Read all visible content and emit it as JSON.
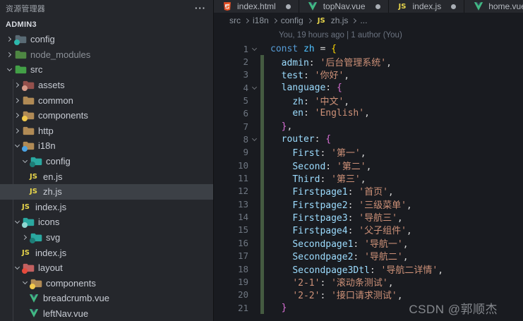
{
  "sidebar": {
    "title": "资源管理器",
    "more_icon": "···",
    "section": "ADMIN3",
    "tree": [
      {
        "label": "config",
        "depth": 0,
        "exp": false,
        "type": "folder",
        "color": "#5a6b75",
        "badge": "#2db8ad",
        "badgeName": "gear-badge"
      },
      {
        "label": "node_modules",
        "depth": 0,
        "exp": false,
        "type": "folder",
        "color": "#4e8743",
        "dim": true
      },
      {
        "label": "src",
        "depth": 0,
        "exp": true,
        "type": "folder",
        "color": "#43a047"
      },
      {
        "label": "assets",
        "depth": 1,
        "exp": false,
        "type": "folder",
        "color": "#94504c",
        "badge": "#d89a8a",
        "badgeName": "image-badge"
      },
      {
        "label": "common",
        "depth": 1,
        "exp": false,
        "type": "folder",
        "color": "#b08a55"
      },
      {
        "label": "components",
        "depth": 1,
        "exp": false,
        "type": "folder",
        "color": "#b08a55",
        "badge": "#f2c94c",
        "badgeName": "puzzle-badge"
      },
      {
        "label": "http",
        "depth": 1,
        "exp": false,
        "type": "folder",
        "color": "#b08a55"
      },
      {
        "label": "i18n",
        "depth": 1,
        "exp": true,
        "type": "folder",
        "color": "#b08a55",
        "badge": "#4ba3e3",
        "badgeName": "translate-badge"
      },
      {
        "label": "config",
        "depth": 2,
        "exp": true,
        "type": "folder",
        "color": "#2aa8a0",
        "badge": "#1d7d77",
        "badgeName": "gear-badge"
      },
      {
        "label": "en.js",
        "depth": 3,
        "type": "js"
      },
      {
        "label": "zh.js",
        "depth": 3,
        "type": "js",
        "selected": true
      },
      {
        "label": "index.js",
        "depth": 2,
        "type": "js"
      },
      {
        "label": "icons",
        "depth": 1,
        "exp": true,
        "type": "folder",
        "color": "#2aa8a0",
        "badge": "#8fd8d2",
        "badgeName": "image-badge"
      },
      {
        "label": "svg",
        "depth": 2,
        "exp": false,
        "type": "folder",
        "color": "#2aa8a0",
        "badge": "#1d7d77",
        "badgeName": "svg-badge"
      },
      {
        "label": "index.js",
        "depth": 2,
        "type": "js"
      },
      {
        "label": "layout",
        "depth": 1,
        "exp": true,
        "type": "folder",
        "color": "#c26060",
        "badge": "#e64a3c",
        "badgeName": "layout-badge"
      },
      {
        "label": "components",
        "depth": 2,
        "exp": true,
        "type": "folder",
        "color": "#b08a55",
        "badge": "#f2c94c",
        "badgeName": "puzzle-badge"
      },
      {
        "label": "breadcrumb.vue",
        "depth": 3,
        "type": "vue"
      },
      {
        "label": "leftNav.vue",
        "depth": 3,
        "type": "vue"
      }
    ]
  },
  "editor": {
    "tabs": [
      {
        "icon": "html",
        "label": "index.html",
        "dot": true
      },
      {
        "icon": "vue",
        "label": "topNav.vue",
        "dot": true
      },
      {
        "icon": "js",
        "label": "index.js",
        "dot": true
      },
      {
        "icon": "vue",
        "label": "home.vue",
        "dot": false
      }
    ],
    "breadcrumb": [
      {
        "label": "src"
      },
      {
        "label": "i18n"
      },
      {
        "label": "config"
      },
      {
        "label": "zh.js",
        "icon": "js"
      },
      {
        "label": "..."
      }
    ],
    "blame": "You, 19 hours ago | 1 author (You)",
    "watermark": "CSDN @郭顺杰",
    "code": {
      "lines": [
        {
          "n": 1,
          "fold": true,
          "git": false,
          "tok": [
            [
              "kw",
              "const"
            ],
            [
              "pun",
              " "
            ],
            [
              "var",
              "zh"
            ],
            [
              "pun",
              " = "
            ],
            [
              "b1",
              "{"
            ]
          ]
        },
        {
          "n": 2,
          "git": true,
          "tok": [
            [
              "pun",
              "  "
            ],
            [
              "key",
              "admin"
            ],
            [
              "pun",
              ": "
            ],
            [
              "str",
              "'后台管理系统'"
            ],
            [
              "pun",
              ","
            ]
          ]
        },
        {
          "n": 3,
          "git": true,
          "tok": [
            [
              "pun",
              "  "
            ],
            [
              "key",
              "test"
            ],
            [
              "pun",
              ": "
            ],
            [
              "str",
              "'你好'"
            ],
            [
              "pun",
              ","
            ]
          ]
        },
        {
          "n": 4,
          "fold": true,
          "git": true,
          "tok": [
            [
              "pun",
              "  "
            ],
            [
              "key",
              "language"
            ],
            [
              "pun",
              ": "
            ],
            [
              "b2",
              "{"
            ]
          ]
        },
        {
          "n": 5,
          "git": true,
          "tok": [
            [
              "pun",
              "    "
            ],
            [
              "key",
              "zh"
            ],
            [
              "pun",
              ": "
            ],
            [
              "str",
              "'中文'"
            ],
            [
              "pun",
              ","
            ]
          ]
        },
        {
          "n": 6,
          "git": true,
          "tok": [
            [
              "pun",
              "    "
            ],
            [
              "key",
              "en"
            ],
            [
              "pun",
              ": "
            ],
            [
              "str",
              "'English'"
            ],
            [
              "pun",
              ","
            ]
          ]
        },
        {
          "n": 7,
          "git": true,
          "tok": [
            [
              "pun",
              "  "
            ],
            [
              "b2",
              "}"
            ],
            [
              "pun",
              ","
            ]
          ]
        },
        {
          "n": 8,
          "fold": true,
          "git": true,
          "tok": [
            [
              "pun",
              "  "
            ],
            [
              "key",
              "router"
            ],
            [
              "pun",
              ": "
            ],
            [
              "b2",
              "{"
            ]
          ]
        },
        {
          "n": 9,
          "git": true,
          "tok": [
            [
              "pun",
              "    "
            ],
            [
              "key",
              "First"
            ],
            [
              "pun",
              ": "
            ],
            [
              "str",
              "'第一'"
            ],
            [
              "pun",
              ","
            ]
          ]
        },
        {
          "n": 10,
          "git": true,
          "tok": [
            [
              "pun",
              "    "
            ],
            [
              "key",
              "Second"
            ],
            [
              "pun",
              ": "
            ],
            [
              "str",
              "'第二'"
            ],
            [
              "pun",
              ","
            ]
          ]
        },
        {
          "n": 11,
          "git": true,
          "tok": [
            [
              "pun",
              "    "
            ],
            [
              "key",
              "Third"
            ],
            [
              "pun",
              ": "
            ],
            [
              "str",
              "'第三'"
            ],
            [
              "pun",
              ","
            ]
          ]
        },
        {
          "n": 12,
          "git": true,
          "tok": [
            [
              "pun",
              "    "
            ],
            [
              "key",
              "Firstpage1"
            ],
            [
              "pun",
              ": "
            ],
            [
              "str",
              "'首页'"
            ],
            [
              "pun",
              ","
            ]
          ]
        },
        {
          "n": 13,
          "git": true,
          "tok": [
            [
              "pun",
              "    "
            ],
            [
              "key",
              "Firstpage2"
            ],
            [
              "pun",
              ": "
            ],
            [
              "str",
              "'三级菜单'"
            ],
            [
              "pun",
              ","
            ]
          ]
        },
        {
          "n": 14,
          "git": true,
          "tok": [
            [
              "pun",
              "    "
            ],
            [
              "key",
              "Firstpage3"
            ],
            [
              "pun",
              ": "
            ],
            [
              "str",
              "'导航三'"
            ],
            [
              "pun",
              ","
            ]
          ]
        },
        {
          "n": 15,
          "git": true,
          "tok": [
            [
              "pun",
              "    "
            ],
            [
              "key",
              "Firstpage4"
            ],
            [
              "pun",
              ": "
            ],
            [
              "str",
              "'父子组件'"
            ],
            [
              "pun",
              ","
            ]
          ]
        },
        {
          "n": 16,
          "git": true,
          "tok": [
            [
              "pun",
              "    "
            ],
            [
              "key",
              "Secondpage1"
            ],
            [
              "pun",
              ": "
            ],
            [
              "str",
              "'导航一'"
            ],
            [
              "pun",
              ","
            ]
          ]
        },
        {
          "n": 17,
          "git": true,
          "tok": [
            [
              "pun",
              "    "
            ],
            [
              "key",
              "Secondpage2"
            ],
            [
              "pun",
              ": "
            ],
            [
              "str",
              "'导航二'"
            ],
            [
              "pun",
              ","
            ]
          ]
        },
        {
          "n": 18,
          "git": true,
          "tok": [
            [
              "pun",
              "    "
            ],
            [
              "key",
              "Secondpage3Dtl"
            ],
            [
              "pun",
              ": "
            ],
            [
              "str",
              "'导航二详情'"
            ],
            [
              "pun",
              ","
            ]
          ]
        },
        {
          "n": 19,
          "git": true,
          "tok": [
            [
              "pun",
              "    "
            ],
            [
              "str",
              "'2-1'"
            ],
            [
              "pun",
              ": "
            ],
            [
              "str",
              "'滚动条测试'"
            ],
            [
              "pun",
              ","
            ]
          ]
        },
        {
          "n": 20,
          "git": true,
          "tok": [
            [
              "pun",
              "    "
            ],
            [
              "str",
              "'2-2'"
            ],
            [
              "pun",
              ": "
            ],
            [
              "str",
              "'接口请求测试'"
            ],
            [
              "pun",
              ","
            ]
          ]
        },
        {
          "n": 21,
          "git": true,
          "tok": [
            [
              "pun",
              "  "
            ],
            [
              "b2",
              "}"
            ]
          ]
        }
      ]
    }
  },
  "colors": {
    "syntax_keyword": "#569cd6",
    "syntax_variable": "#4fc1ff",
    "syntax_property": "#9cdcfe",
    "syntax_string": "#ce9178",
    "bracket_level1": "#ffd700",
    "bracket_level2": "#da70d6",
    "git_added_gutter": "#455b41",
    "js_icon": "#e7d54b",
    "vue_icon": "#41b883",
    "html_icon": "#e44d26",
    "sidebar_bg": "#25272c",
    "editor_bg": "#191b20",
    "selection_bg": "#3c4046"
  }
}
